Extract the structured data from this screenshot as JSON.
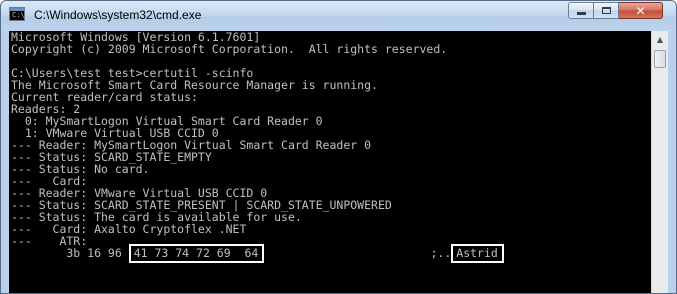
{
  "window": {
    "title": "C:\\Windows\\system32\\cmd.exe",
    "icon": "cmd-icon",
    "icon_prompt": "C:\\"
  },
  "caption_buttons": {
    "minimize_icon": "minimize-icon",
    "maximize_icon": "maximize-icon",
    "close_label": "✕"
  },
  "scrollbar": {
    "up_arrow": "▲"
  },
  "console": {
    "lines": [
      "Microsoft Windows [Version 6.1.7601]",
      "Copyright (c) 2009 Microsoft Corporation.  All rights reserved.",
      "",
      "C:\\Users\\test test>certutil -scinfo",
      "The Microsoft Smart Card Resource Manager is running.",
      "Current reader/card status:",
      "Readers: 2",
      "  0: MySmartLogon Virtual Smart Card Reader 0",
      "  1: VMware Virtual USB CCID 0",
      "--- Reader: MySmartLogon Virtual Smart Card Reader 0",
      "--- Status: SCARD_STATE_EMPTY",
      "--- Status: No card.",
      "---   Card:",
      "--- Reader: VMware Virtual USB CCID 0",
      "--- Status: SCARD_STATE_PRESENT | SCARD_STATE_UNPOWERED",
      "--- Status: The card is available for use.",
      "---   Card: Axalto Cryptoflex .NET",
      "---    ATR:"
    ],
    "atr_line": {
      "prefix": "        3b 16 96 ",
      "highlight_hex": "41 73 74 72 69  64",
      "middle": "                        ;..",
      "highlight_ascii": "Astrid"
    }
  }
}
